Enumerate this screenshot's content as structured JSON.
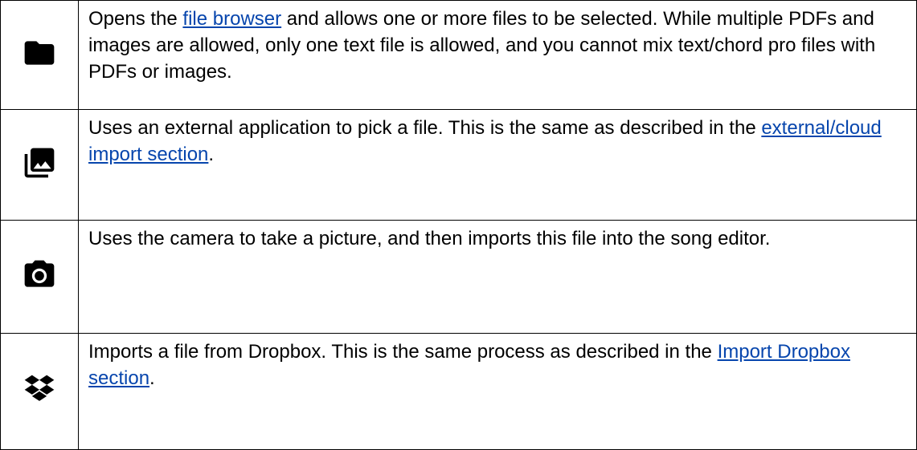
{
  "rows": [
    {
      "icon": "folder-icon",
      "text_before": "Opens the ",
      "link": "file browser",
      "text_after": " and allows one or more files to be selected.  While multiple PDFs and images are allowed, only one text file is allowed, and you cannot mix text/chord pro files with PDFs or images."
    },
    {
      "icon": "photo-library-icon",
      "text_before": "Uses an external application to pick a file. This is the same as described in the ",
      "link": "external/cloud import section",
      "text_after": "."
    },
    {
      "icon": "camera-icon",
      "text_before": "Uses the camera to take a picture, and then imports this file into the song editor.",
      "link": "",
      "text_after": ""
    },
    {
      "icon": "dropbox-icon",
      "text_before": "Imports a file from Dropbox. This is the same process as described in the ",
      "link": "Import Dropbox section",
      "text_after": "."
    }
  ],
  "colors": {
    "link": "#0645ad",
    "border": "#000000",
    "text": "#000000"
  }
}
